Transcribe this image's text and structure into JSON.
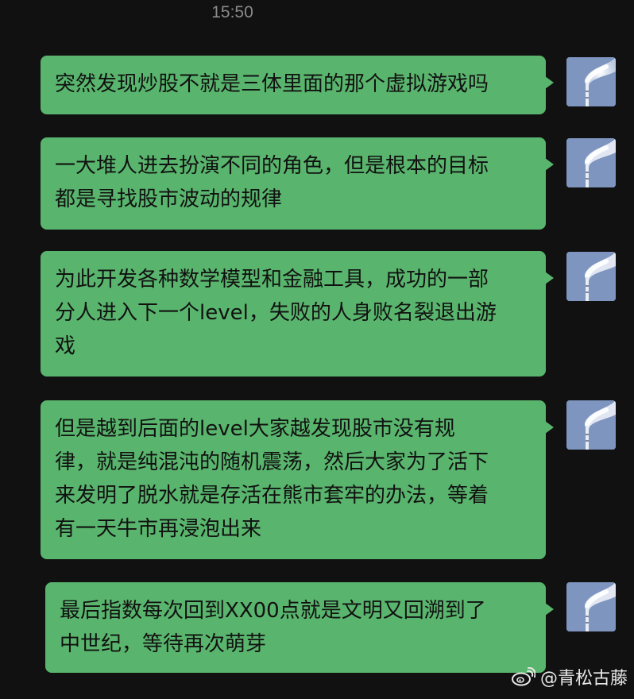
{
  "status": {
    "time": "15:50"
  },
  "messages": [
    {
      "lines": [
        "突然发现炒股不就是三体里面的那个虚拟游戏吗"
      ]
    },
    {
      "lines": [
        "一大堆人进去扮演不同的角色，但是根本的目标",
        "都是寻找股市波动的规律"
      ]
    },
    {
      "lines": [
        "为此开发各种数学模型和金融工具，成功的一部",
        "分人进入下一个level，失败的人身败名裂退出游",
        "戏"
      ]
    },
    {
      "lines": [
        "但是越到后面的level大家越发现股市没有规",
        "律，就是纯混沌的随机震荡，然后大家为了活下",
        "来发明了脱水就是存活在熊市套牢的办法，等着",
        "有一天牛市再浸泡出来"
      ]
    },
    {
      "lines": [
        "最后指数每次回到XX00点就是文明又回溯到了",
        "中世纪，等待再次萌芽"
      ]
    }
  ],
  "avatar": {
    "icon": "smokestack-avatar-icon"
  },
  "watermark": {
    "text": "@青松古藤",
    "icon": "weibo-icon"
  },
  "colors": {
    "background": "#111111",
    "bubble": "#59b56d",
    "text": "#111111",
    "timestamp": "#8a8a8a"
  }
}
